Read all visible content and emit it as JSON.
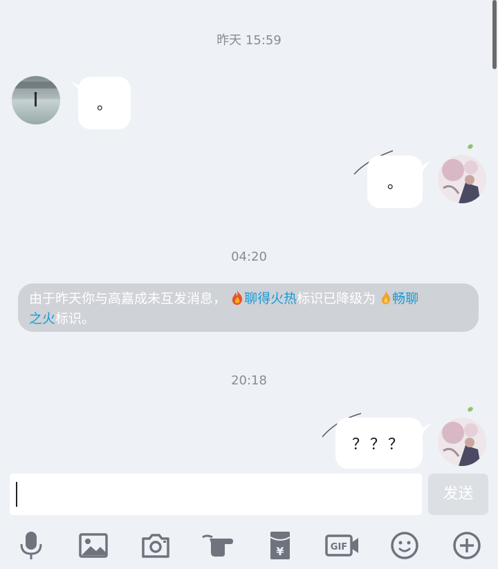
{
  "timestamps": [
    "昨天 15:59",
    "04:20",
    "20:18"
  ],
  "messages": [
    {
      "side": "left",
      "text": "。"
    },
    {
      "side": "right",
      "text": "。"
    },
    {
      "side": "right",
      "text": "？？？"
    }
  ],
  "notice": {
    "prefix": "由于昨天你与高嘉成未互发消息，",
    "level_from": "聊得火热",
    "middle": "标识已降级为",
    "level_to_part1": "畅聊",
    "level_to_part2": "之火",
    "suffix": "标识。"
  },
  "composer": {
    "input_value": "",
    "send_label": "发送"
  },
  "toolbar": [
    "microphone-icon",
    "image-icon",
    "camera-icon",
    "poke-hand-icon",
    "red-packet-icon",
    "gif-icon",
    "emoji-icon",
    "plus-icon"
  ],
  "colors": {
    "background": "#eef1f6",
    "bubble": "#ffffff",
    "highlight": "#1a9ad6",
    "notice_bg": "#cfd2d7",
    "icon": "#6f737d"
  }
}
